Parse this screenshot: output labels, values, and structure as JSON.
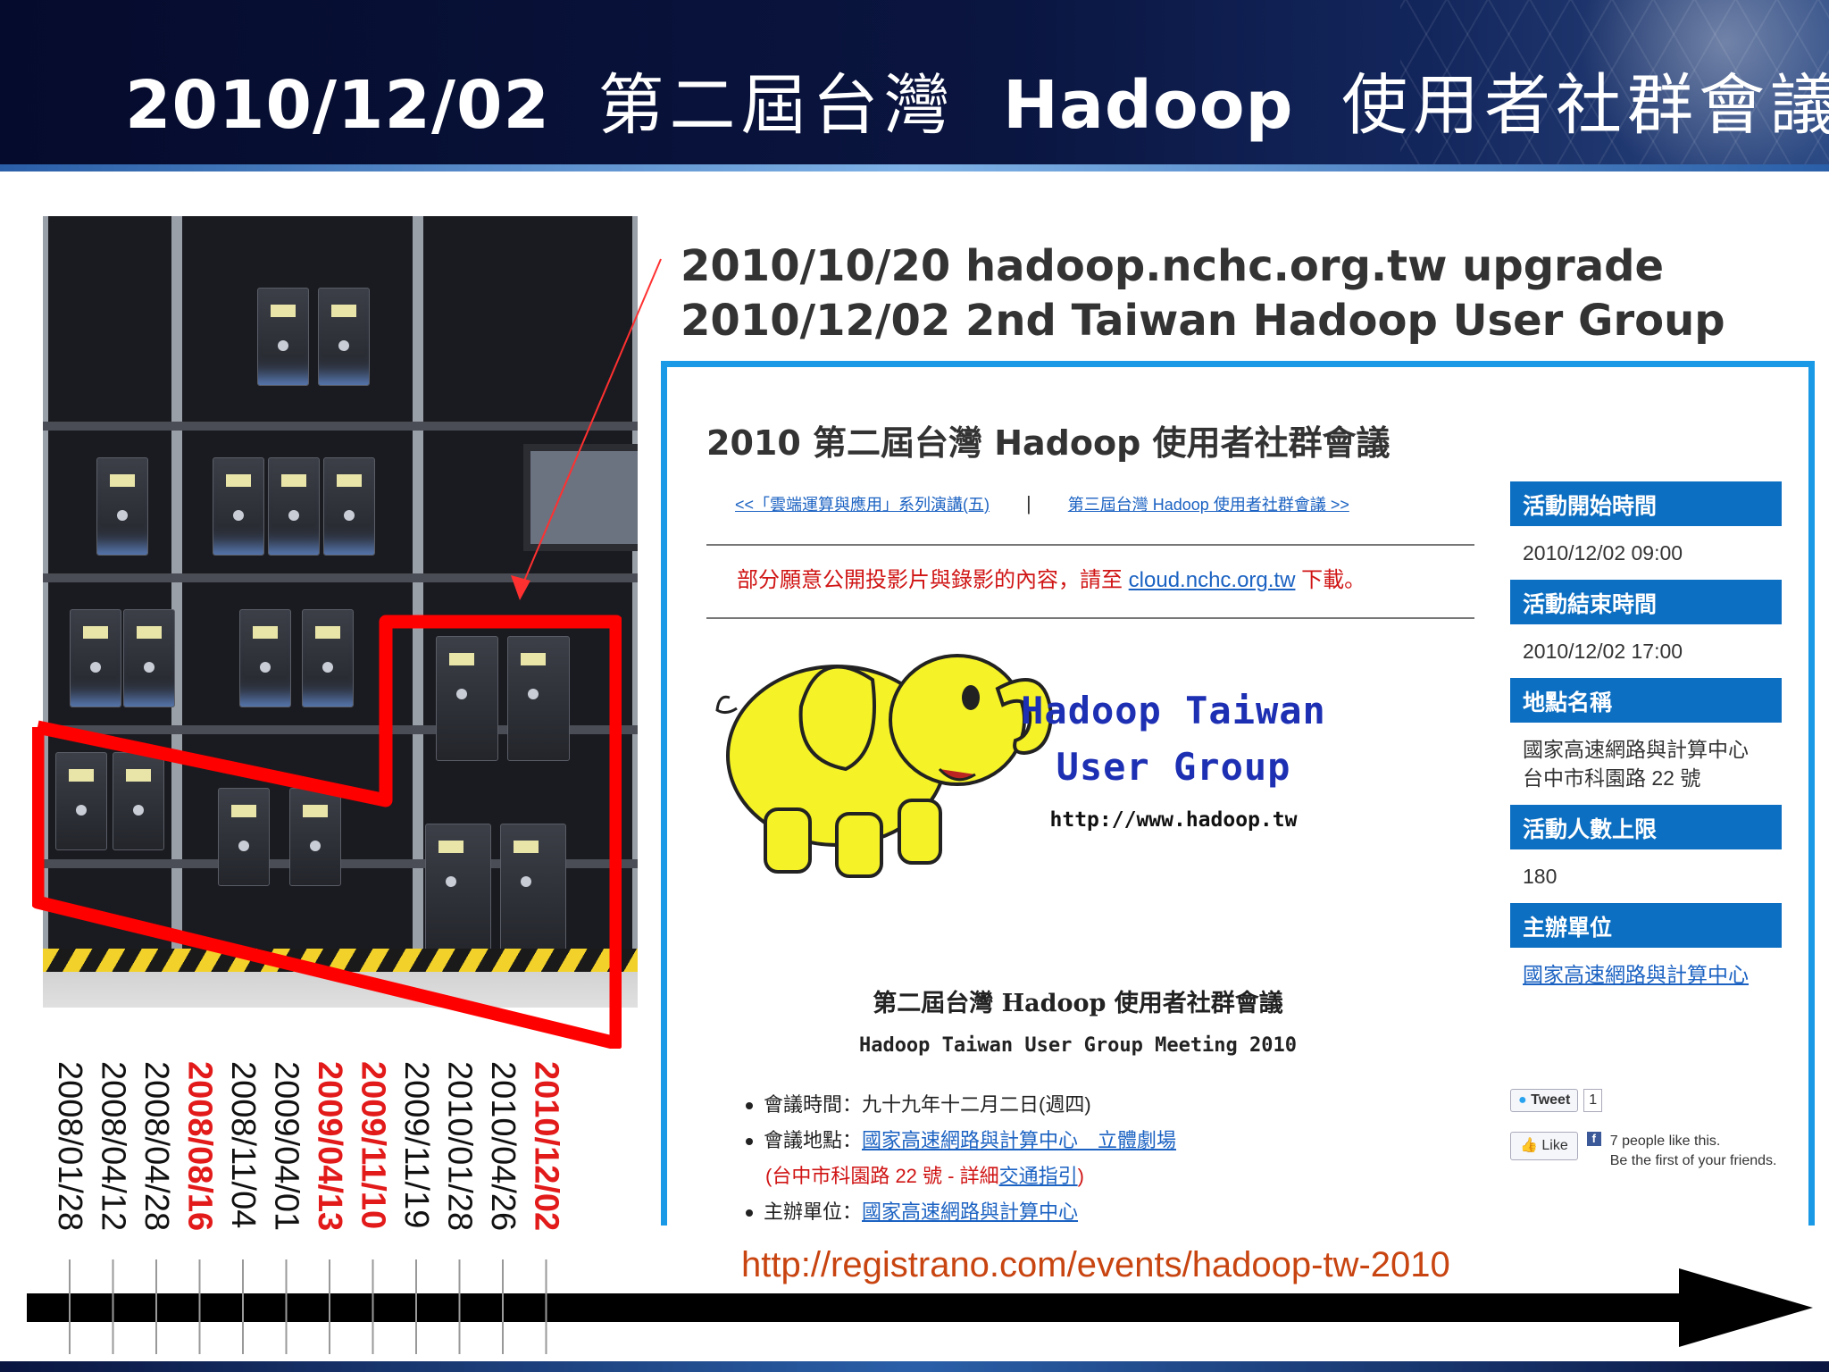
{
  "header": {
    "date": "2010/12/02",
    "title_zh_1": "第二屆台灣",
    "title_en": "Hadoop",
    "title_zh_2": "使用者社群會議"
  },
  "upgrade_lines": [
    "2010/10/20 hadoop.nchc.org.tw upgrade",
    "2010/12/02 2nd Taiwan Hadoop User Group"
  ],
  "site": {
    "title": "2010 第二屆台灣 Hadoop 使用者社群會議",
    "prev_link": "<<「雲端運算與應用」系列演講(五)",
    "separator": "|",
    "next_link": "第三屆台灣 Hadoop 使用者社群會議 >>",
    "notice_prefix": "部分願意公開投影片與錄影的內容，請至 ",
    "notice_link": "cloud.nchc.org.tw",
    "notice_suffix": " 下載。",
    "logo": {
      "line1": "Hadoop Taiwan",
      "line2": "User Group",
      "line3": "http://www.hadoop.tw"
    },
    "meeting_title_zh": "第二屆台灣 Hadoop 使用者社群會議",
    "meeting_title_en": "Hadoop Taiwan User Group Meeting 2010",
    "bullets": {
      "time_label": "會議時間：",
      "time_value": "九十九年十二月二日(週四)",
      "place_label": "會議地點：",
      "place_link": "國家高速網路與計算中心　立體劇場",
      "addr_prefix": "(台中市科園路 22 號 - 詳細",
      "addr_link": "交通指引",
      "addr_suffix": ")",
      "host_label": "主辦單位：",
      "host_link": "國家高速網路與計算中心"
    },
    "sidebar": [
      {
        "head": "活動開始時間",
        "value": "2010/12/02 09:00"
      },
      {
        "head": "活動結束時間",
        "value": "2010/12/02 17:00"
      },
      {
        "head": "地點名稱",
        "value": "國家高速網路與計算中心",
        "value2": "台中市科園路 22 號"
      },
      {
        "head": "活動人數上限",
        "value": "180"
      },
      {
        "head": "主辦單位",
        "value": "國家高速網路與計算中心"
      }
    ],
    "social": {
      "tweet_label": "Tweet",
      "tweet_count": "1",
      "like_label": "Like",
      "fb_letter": "f",
      "like_text_1": "7 people like this.",
      "like_text_2": "Be the first of your friends."
    }
  },
  "registration_url": "http://registrano.com/events/hadoop-tw-2010",
  "timeline": {
    "dates": [
      {
        "label": "2008/01/28",
        "highlight": false
      },
      {
        "label": "2008/04/12",
        "highlight": false
      },
      {
        "label": "2008/04/28",
        "highlight": false
      },
      {
        "label": "2008/08/16",
        "highlight": true
      },
      {
        "label": "2008/11/04",
        "highlight": false
      },
      {
        "label": "2009/04/01",
        "highlight": false
      },
      {
        "label": "2009/04/13",
        "highlight": true
      },
      {
        "label": "2009/11/10",
        "highlight": true
      },
      {
        "label": "2009/11/19",
        "highlight": false
      },
      {
        "label": "2010/01/28",
        "highlight": false
      },
      {
        "label": "2010/04/26",
        "highlight": false
      },
      {
        "label": "2010/12/02",
        "highlight": true
      }
    ],
    "highlight_color": "#e21a1a"
  },
  "colors": {
    "header_bg": "#050b2c",
    "site_border": "#1a9ae6",
    "sidebar_head": "#0d6fc2",
    "link": "#1b62c2",
    "notice": "#d01414",
    "url": "#c84410",
    "outline": "#ff0000"
  }
}
